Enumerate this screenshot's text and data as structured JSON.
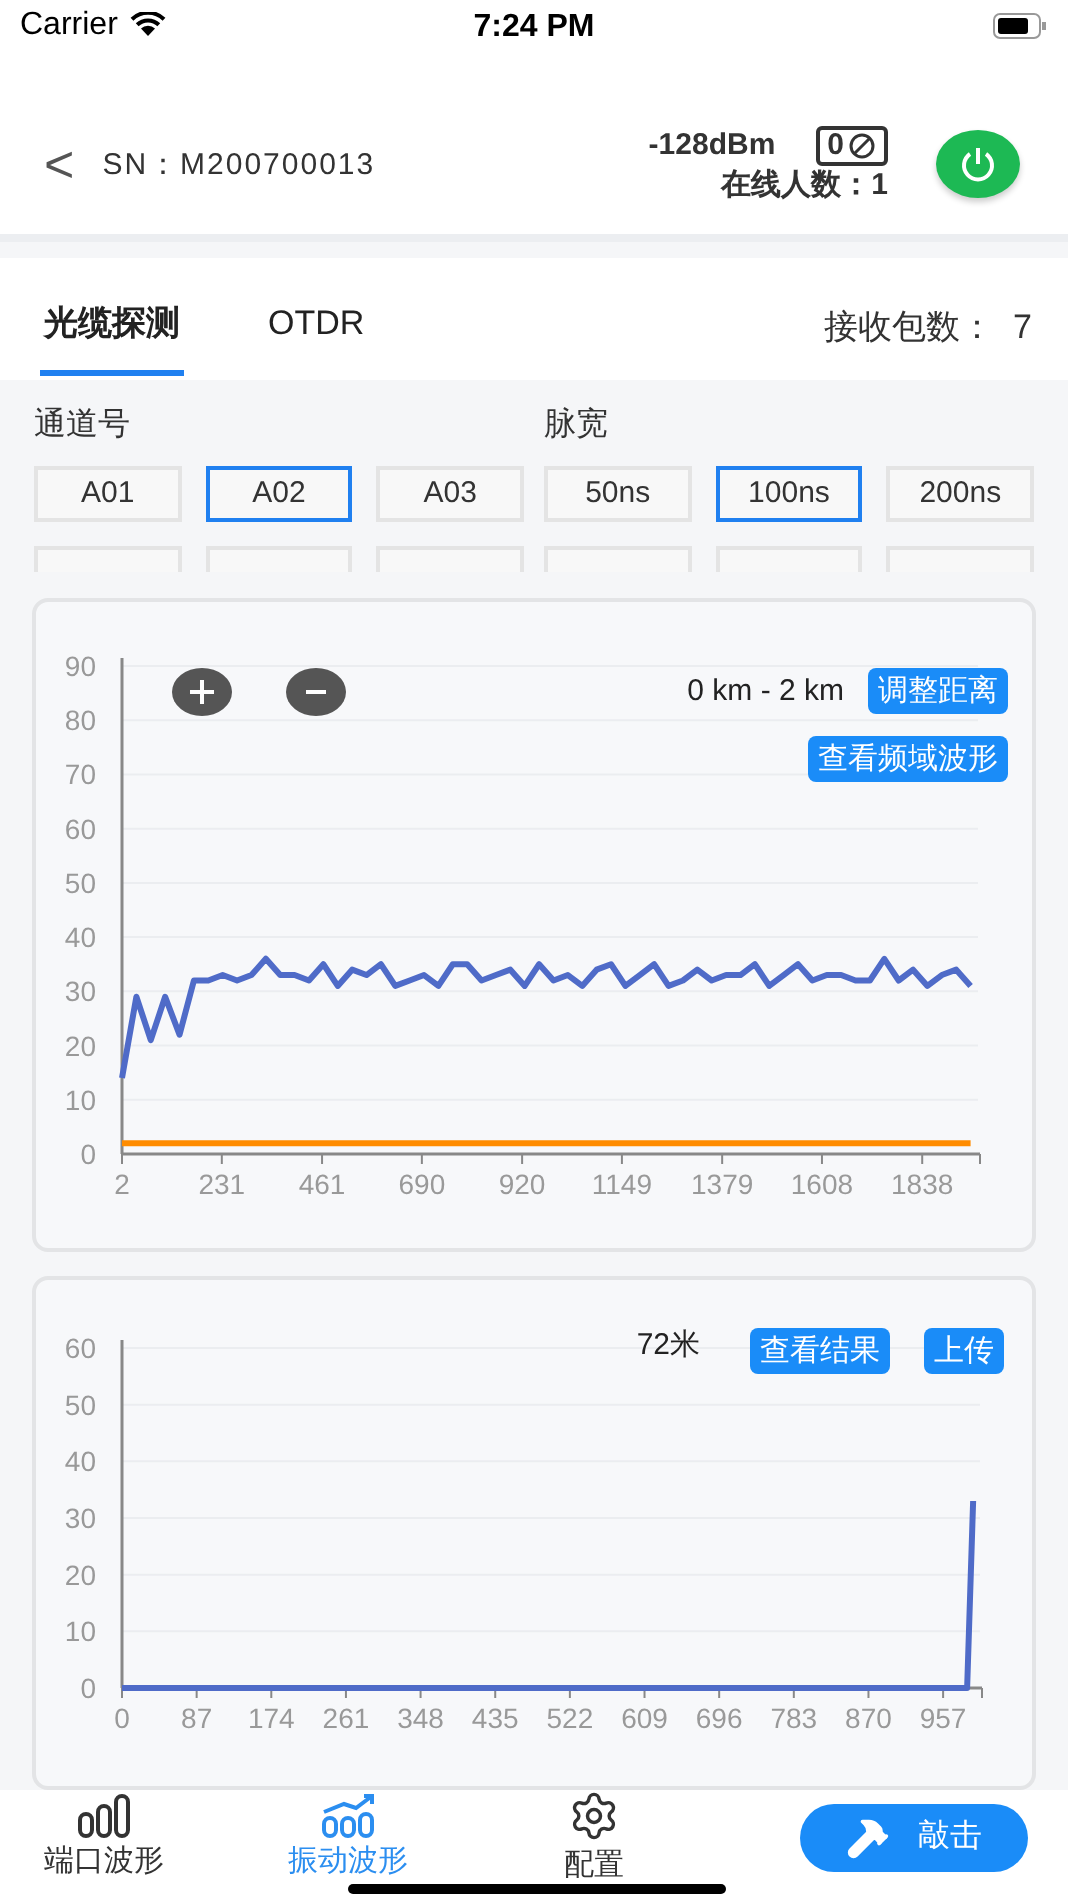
{
  "status_bar": {
    "carrier": "Carrier",
    "time": "7:24 PM"
  },
  "header": {
    "back": "<",
    "serial": "SN：M200700013",
    "signal": "-128dBm",
    "counter": "0",
    "online": "在线人数：1"
  },
  "tabs": [
    {
      "label": "光缆探测",
      "selected": true
    },
    {
      "label": "OTDR",
      "selected": false
    }
  ],
  "packets": "接收包数：  7",
  "channels": {
    "label": "通道号",
    "options": [
      {
        "label": "A01",
        "selected": false
      },
      {
        "label": "A02",
        "selected": true
      },
      {
        "label": "A03",
        "selected": false
      }
    ]
  },
  "pulse_width": {
    "label": "脉宽",
    "options": [
      {
        "label": "50ns",
        "selected": false
      },
      {
        "label": "100ns",
        "selected": true
      },
      {
        "label": "200ns",
        "selected": false
      }
    ]
  },
  "waveform_panel": {
    "range": "0 km - 2 km",
    "adjust_button": "调整距离",
    "spectrum_button": "查看频域波形",
    "chart_data": {
      "type": "line",
      "x": [
        2,
        35,
        68,
        101,
        134,
        167,
        200,
        233,
        266,
        299,
        332,
        365,
        398,
        431,
        464,
        497,
        530,
        563,
        596,
        629,
        662,
        695,
        728,
        761,
        794,
        827,
        860,
        893,
        926,
        959,
        992,
        1025,
        1058,
        1091,
        1124,
        1157,
        1190,
        1223,
        1256,
        1289,
        1322,
        1355,
        1388,
        1421,
        1454,
        1487,
        1520,
        1553,
        1586,
        1619,
        1652,
        1685,
        1718,
        1751,
        1784,
        1817,
        1850,
        1883,
        1916,
        1949
      ],
      "xlim": [
        2,
        1966
      ],
      "xticks": [
        2,
        231,
        461,
        690,
        920,
        1149,
        1379,
        1608,
        1838
      ],
      "ylim": [
        0,
        90
      ],
      "yticks": [
        0,
        10,
        20,
        30,
        40,
        50,
        60,
        70,
        80,
        90
      ],
      "grid": true,
      "series": [
        {
          "color": "#4f6bc8",
          "values": [
            14,
            29,
            21,
            29,
            22,
            32,
            32,
            33,
            32,
            33,
            36,
            33,
            33,
            32,
            35,
            31,
            34,
            33,
            35,
            31,
            32,
            33,
            31,
            35,
            35,
            32,
            33,
            34,
            31,
            35,
            32,
            33,
            31,
            34,
            35,
            31,
            33,
            35,
            31,
            32,
            34,
            32,
            33,
            33,
            35,
            31,
            33,
            35,
            32,
            33,
            33,
            32,
            32,
            36,
            32,
            34,
            31,
            33,
            34,
            31
          ]
        },
        {
          "color": "#ff8c00",
          "values": [
            2,
            2,
            2,
            2,
            2,
            2,
            2,
            2,
            2,
            2,
            2,
            2,
            2,
            2,
            2,
            2,
            2,
            2,
            2,
            2,
            2,
            2,
            2,
            2,
            2,
            2,
            2,
            2,
            2,
            2,
            2,
            2,
            2,
            2,
            2,
            2,
            2,
            2,
            2,
            2,
            2,
            2,
            2,
            2,
            2,
            2,
            2,
            2,
            2,
            2,
            2,
            2,
            2,
            2,
            2,
            2,
            2,
            2,
            2,
            2
          ]
        }
      ]
    }
  },
  "result_panel": {
    "distance": "72米",
    "result_button": "查看结果",
    "upload_button": "上传",
    "chart_data": {
      "type": "line",
      "x": [
        0,
        87,
        174,
        261,
        348,
        435,
        522,
        609,
        696,
        783,
        870,
        957,
        985,
        992
      ],
      "xlim": [
        0,
        1000
      ],
      "xticks": [
        0,
        87,
        174,
        261,
        348,
        435,
        522,
        609,
        696,
        783,
        870,
        957
      ],
      "ylim": [
        0,
        60
      ],
      "yticks": [
        0,
        10,
        20,
        30,
        40,
        50,
        60
      ],
      "grid": true,
      "series": [
        {
          "color": "#4f6bc8",
          "values": [
            0,
            0,
            0,
            0,
            0,
            0,
            0,
            0,
            0,
            0,
            0,
            0,
            0,
            33
          ]
        }
      ]
    }
  },
  "bottom_nav": [
    {
      "label": "端口波形",
      "kind": "bars",
      "selected": false
    },
    {
      "label": "振动波形",
      "kind": "trend",
      "selected": true
    },
    {
      "label": "配置",
      "kind": "gear",
      "selected": false
    }
  ],
  "tap_button": "敲击"
}
